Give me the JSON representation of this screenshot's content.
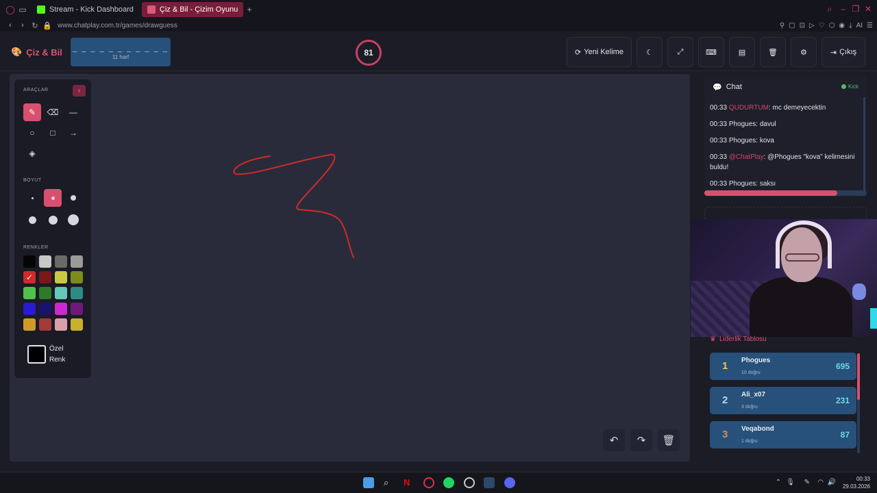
{
  "browser": {
    "tabs": [
      {
        "label": "Stream - Kick Dashboard"
      },
      {
        "label": "Çiz & Bil - Çizim Oyunu"
      }
    ],
    "url": "www.chatplay.com.tr/games/drawguess",
    "ai_label": "AI"
  },
  "app": {
    "logo": "Çiz & Bil",
    "word_mask": "_ _ _ _ _ _ _ _ _ _ _",
    "word_hint": "11 harf",
    "timer": "81",
    "buttons": {
      "new_word": "Yeni Kelime",
      "exit": "Çıkış"
    }
  },
  "tools": {
    "section_tools": "ARAÇLAR",
    "section_size": "BOYUT",
    "section_colors": "RENKLER",
    "custom_color_label": "Özel Renk",
    "selected_color": "#d02a2a",
    "colors": [
      "#050505",
      "#c8c8c8",
      "#6a6a6a",
      "#9a9a9a",
      "#d02a2a",
      "#7a1818",
      "#c8c842",
      "#7e8a1c",
      "#4fc24a",
      "#2e7a2a",
      "#62c8b8",
      "#2e8a84",
      "#2a1ad0",
      "#1a1270",
      "#c82ad0",
      "#6e1a7a",
      "#d09a2a",
      "#a23a3a",
      "#d8a0a8",
      "#c8b02a"
    ]
  },
  "chat": {
    "title": "Chat",
    "platform": "Kick",
    "messages": [
      {
        "time": "00:33",
        "user": "QUDURTUM",
        "text": ": mc demeyecektin"
      },
      {
        "time": "00:33",
        "user": "Phogues",
        "text": ": davul"
      },
      {
        "time": "00:33",
        "user": "Phogues",
        "text": ": kova"
      },
      {
        "time": "00:33",
        "user": "@ChatPlay",
        "text": ": @Phogues \"kova\" kelimesini buldu!"
      },
      {
        "time": "00:33",
        "user": "Phogues",
        "text": ": saksı"
      }
    ]
  },
  "leaderboard": {
    "title": "Liderlik Tablosu",
    "rows": [
      {
        "rank": "1",
        "name": "Phogues",
        "sub": "10 doğru",
        "score": "695",
        "rank_color": "#e8c850"
      },
      {
        "rank": "2",
        "name": "Ali_x07",
        "sub": "3 doğru",
        "score": "231",
        "rank_color": "#c8d0dc"
      },
      {
        "rank": "3",
        "name": "Veqabond",
        "sub": "1 doğru",
        "score": "87",
        "rank_color": "#d09060"
      }
    ]
  },
  "taskbar": {
    "time": "00:33",
    "date": "29.03.2026"
  }
}
